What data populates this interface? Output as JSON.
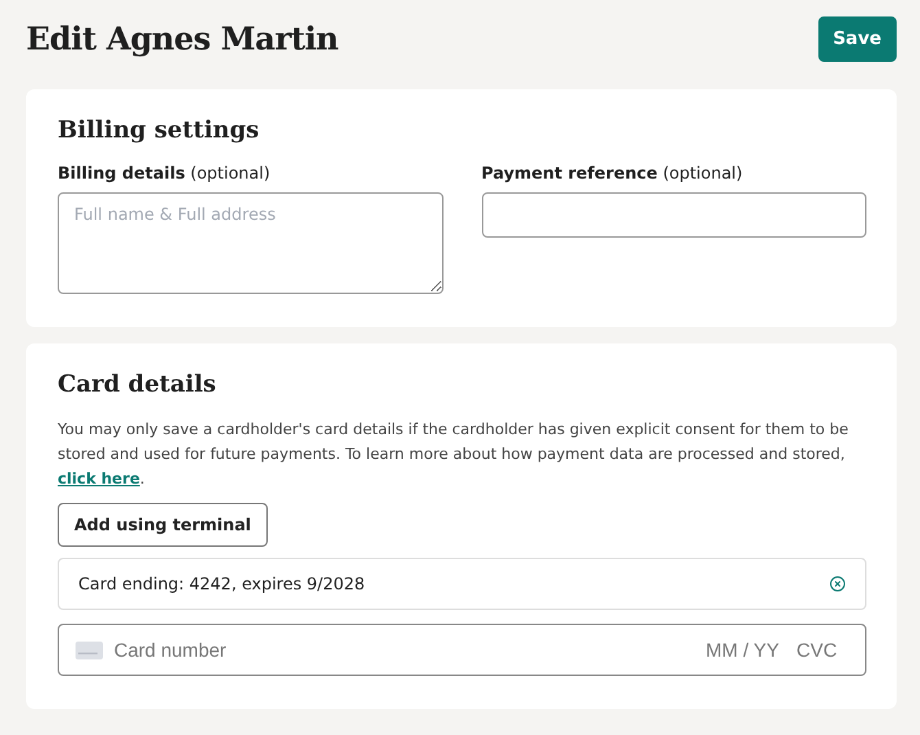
{
  "title": "Edit Agnes Martin",
  "save_button": "Save",
  "billing": {
    "heading": "Billing settings",
    "fields": [
      {
        "kind": "textarea",
        "label": "**Billing details** (optional)",
        "placeholder": "Full name & Full address"
      },
      {
        "kind": "input",
        "label": "**Payment reference** (optional)"
      }
    ]
  },
  "card": {
    "heading": "Card details",
    "notice": "You may only save a cardholder's card details if the cardholder has given explicit consent for them to be stored and used for future payments. To learn more about how payment data are processed and stored,",
    "link": "click here",
    "notice_end": ".",
    "terminal_button": "Add using terminal",
    "saved_card": "Card ending: 4242, expires 9/2028",
    "number_placeholder": "Card number",
    "expiry_placeholder": "MM / YY",
    "cvc_placeholder": "CVC"
  }
}
